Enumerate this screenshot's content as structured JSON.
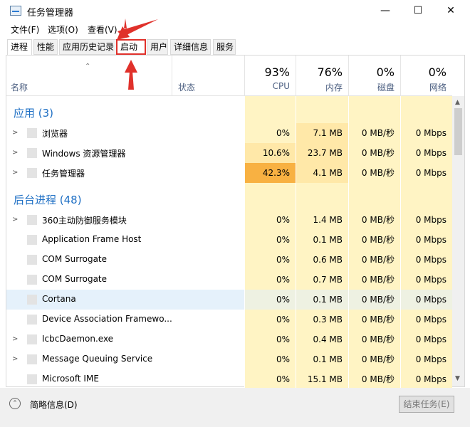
{
  "window": {
    "title": "任务管理器",
    "min": "—",
    "max": "☐",
    "close": "✕"
  },
  "menu": [
    "文件(F)",
    "选项(O)",
    "查看(V)"
  ],
  "tabs": [
    "进程",
    "性能",
    "应用历史记录",
    "启动",
    "用户",
    "详细信息",
    "服务"
  ],
  "header": {
    "name": "名称",
    "status": "状态",
    "cpu_pct": "93%",
    "cpu_label": "CPU",
    "mem_pct": "76%",
    "mem_label": "内存",
    "disk_pct": "0%",
    "disk_label": "磁盘",
    "net_pct": "0%",
    "net_label": "网络"
  },
  "groups": {
    "apps": "应用 (3)",
    "background": "后台进程 (48)"
  },
  "apps": [
    {
      "name": "浏览器",
      "cpu": "0%",
      "mem": "7.1 MB",
      "disk": "0 MB/秒",
      "net": "0 Mbps"
    },
    {
      "name": "Windows 资源管理器",
      "cpu": "10.6%",
      "mem": "23.7 MB",
      "disk": "0 MB/秒",
      "net": "0 Mbps"
    },
    {
      "name": "任务管理器",
      "cpu": "42.3%",
      "mem": "4.1 MB",
      "disk": "0 MB/秒",
      "net": "0 Mbps"
    }
  ],
  "background": [
    {
      "name": "360主动防御服务模块",
      "cpu": "0%",
      "mem": "1.4 MB",
      "disk": "0 MB/秒",
      "net": "0 Mbps"
    },
    {
      "name": "Application Frame Host",
      "cpu": "0%",
      "mem": "0.1 MB",
      "disk": "0 MB/秒",
      "net": "0 Mbps"
    },
    {
      "name": "COM Surrogate",
      "cpu": "0%",
      "mem": "0.6 MB",
      "disk": "0 MB/秒",
      "net": "0 Mbps"
    },
    {
      "name": "COM Surrogate",
      "cpu": "0%",
      "mem": "0.7 MB",
      "disk": "0 MB/秒",
      "net": "0 Mbps"
    },
    {
      "name": "Cortana",
      "cpu": "0%",
      "mem": "0.1 MB",
      "disk": "0 MB/秒",
      "net": "0 Mbps"
    },
    {
      "name": "Device Association Framewo...",
      "cpu": "0%",
      "mem": "0.3 MB",
      "disk": "0 MB/秒",
      "net": "0 Mbps"
    },
    {
      "name": "IcbcDaemon.exe",
      "cpu": "0%",
      "mem": "0.4 MB",
      "disk": "0 MB/秒",
      "net": "0 Mbps"
    },
    {
      "name": "Message Queuing Service",
      "cpu": "0%",
      "mem": "0.1 MB",
      "disk": "0 MB/秒",
      "net": "0 Mbps"
    },
    {
      "name": "Microsoft IME",
      "cpu": "0%",
      "mem": "15.1 MB",
      "disk": "0 MB/秒",
      "net": "0 Mbps"
    }
  ],
  "footer": {
    "fewer_details": "简略信息(D)",
    "end_task": "结束任务(E)"
  },
  "icons": {
    "fewer": "chevron-up-icon",
    "expand": "chevron-right-icon"
  },
  "colors": {
    "accent": "#1e6fc4",
    "cpu_heat_low": "#fff4c4",
    "cpu_heat_mid": "#ffe8a8",
    "cpu_heat_high": "#f8b142",
    "annotation": "#e0312b"
  }
}
